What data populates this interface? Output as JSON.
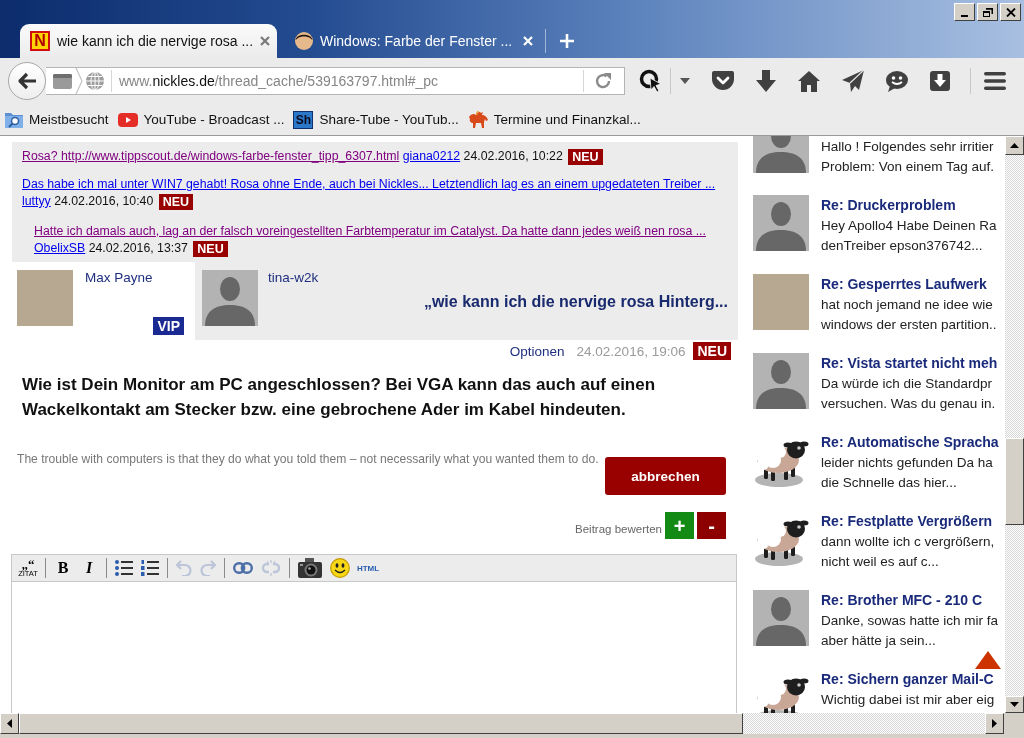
{
  "tabs": [
    {
      "title": "wie kann ich die nervige rosa ...",
      "icon": {
        "kind": "letter",
        "text": "N"
      },
      "selected": true
    },
    {
      "title": "Windows: Farbe der Fenster ...",
      "icon": {
        "kind": "avatar"
      },
      "selected": false
    }
  ],
  "address_bar": {
    "url_parts": [
      {
        "text": "www.",
        "host": false
      },
      {
        "text": "nickles.de",
        "host": true
      },
      {
        "text": "/thread_cache/539163797.html#_pc",
        "host": false
      }
    ]
  },
  "bookmarks": [
    {
      "label": "Meistbesucht",
      "kind": "folder"
    },
    {
      "label": "YouTube - Broadcast ...",
      "kind": "video"
    },
    {
      "label": "Share-Tube - YouTub...",
      "kind": "tile",
      "icon_text": "Sh"
    },
    {
      "label": "Termine und Finanzkal...",
      "kind": "bull"
    }
  ],
  "thread": [
    {
      "title": "Rosa? http://www.tippscout.de/windows-farbe-fenster_tipp_6307.html",
      "visited": true,
      "author": "giana0212",
      "date": "24.02.2016, 10:22",
      "badge": "NEU"
    },
    {
      "title": "Das habe ich mal unter WIN7 gehabt! Rosa ohne Ende, auch bei Nickles... Letztendlich lag es an einem upgedateten Treiber ...",
      "visited": false,
      "author": "luttyy",
      "date": "24.02.2016, 10:40",
      "badge": "NEU",
      "children": [
        {
          "title": "Hatte ich damals auch, lag an der falsch voreingestellten Farbtemperatur im Catalyst. Da hatte dann jedes weiß nen rosa ...",
          "visited": true,
          "author": "ObelixSB",
          "date": "24.02.2016, 13:37",
          "badge": "NEU"
        }
      ]
    }
  ],
  "author": {
    "name": "Max Payne",
    "badge": "VIP",
    "avatar": {
      "kind": "photo"
    }
  },
  "topic": {
    "user": "tina-w2k",
    "avatar": {
      "kind": "silhouette"
    },
    "title": "„wie kann ich die nervige rosa Hinterg..."
  },
  "post": {
    "options": "Optionen",
    "date": "24.02.2016, 19:06",
    "badge": "NEU",
    "body": "Wie ist Dein Monitor am PC angeschlossen? Bei VGA kann das auch auf einen Wackelkontakt am Stecker bzw. eine gebrochene Ader im Kabel hindeuten.",
    "signature": "The trouble with computers is that they do what you told them – not necessarily what you wanted them to do.",
    "cancel_button": "abbrechen"
  },
  "rating": {
    "label": "Beitrag bewerten",
    "up": "+",
    "down": "-"
  },
  "editor": {
    "tool_groups": [
      {
        "tools": [
          {
            "kind": "quote",
            "glyph": "„“",
            "label": "ZITAT",
            "disabled": false
          }
        ]
      },
      {
        "tools": [
          {
            "kind": "bold",
            "glyph": "B",
            "disabled": false
          },
          {
            "kind": "italic",
            "glyph": "I",
            "disabled": false
          }
        ]
      },
      {
        "tools": [
          {
            "kind": "bullets",
            "disabled": false
          },
          {
            "kind": "numbers",
            "disabled": false
          }
        ]
      },
      {
        "tools": [
          {
            "kind": "undo",
            "disabled": true
          },
          {
            "kind": "redo",
            "disabled": true
          }
        ]
      },
      {
        "tools": [
          {
            "kind": "link",
            "disabled": false
          },
          {
            "kind": "unlink",
            "disabled": true
          }
        ]
      },
      {
        "tools": [
          {
            "kind": "camera",
            "disabled": false
          },
          {
            "kind": "smiley",
            "disabled": false
          },
          {
            "kind": "html",
            "label": "HTML",
            "disabled": false
          }
        ]
      }
    ]
  },
  "sidebar": [
    {
      "avatar": {
        "kind": "silhouette"
      },
      "excerpt": [
        "Hallo ! Folgendes sehr irritier",
        "Problem: Von einem Tag auf."
      ]
    },
    {
      "avatar": {
        "kind": "silhouette"
      },
      "title": "Re: Druckerproblem",
      "excerpt": [
        "Hey Apollo4 Habe Deinen Ra",
        "denTreiber epson376742..."
      ]
    },
    {
      "avatar": {
        "kind": "photo"
      },
      "title": "Re: Gesperrtes Laufwerk",
      "excerpt": [
        "hat noch jemand ne idee wie",
        "windows der ersten partition.."
      ]
    },
    {
      "avatar": {
        "kind": "silhouette"
      },
      "title": "Re: Vista startet nicht meh",
      "excerpt": [
        "Da würde ich die Standardpr",
        "versuchen. Was du genau in."
      ]
    },
    {
      "avatar": {
        "kind": "sheep"
      },
      "title": "Re: Automatische Spracha",
      "excerpt": [
        "leider nichts gefunden Da ha",
        "die Schnelle das hier..."
      ]
    },
    {
      "avatar": {
        "kind": "sheep"
      },
      "title": "Re: Festplatte Vergrößern",
      "excerpt": [
        "dann wollte ich c vergrößern,",
        "nicht weil es auf c..."
      ]
    },
    {
      "avatar": {
        "kind": "silhouette"
      },
      "title": "Re: Brother MFC - 210 C",
      "excerpt": [
        "Danke, sowas hatte ich mir fa",
        "aber hätte ja sein..."
      ]
    },
    {
      "avatar": {
        "kind": "sheep"
      },
      "title": "Re: Sichern ganzer Mail-C",
      "excerpt": [
        "Wichtig dabei ist mir aber eig"
      ]
    }
  ]
}
